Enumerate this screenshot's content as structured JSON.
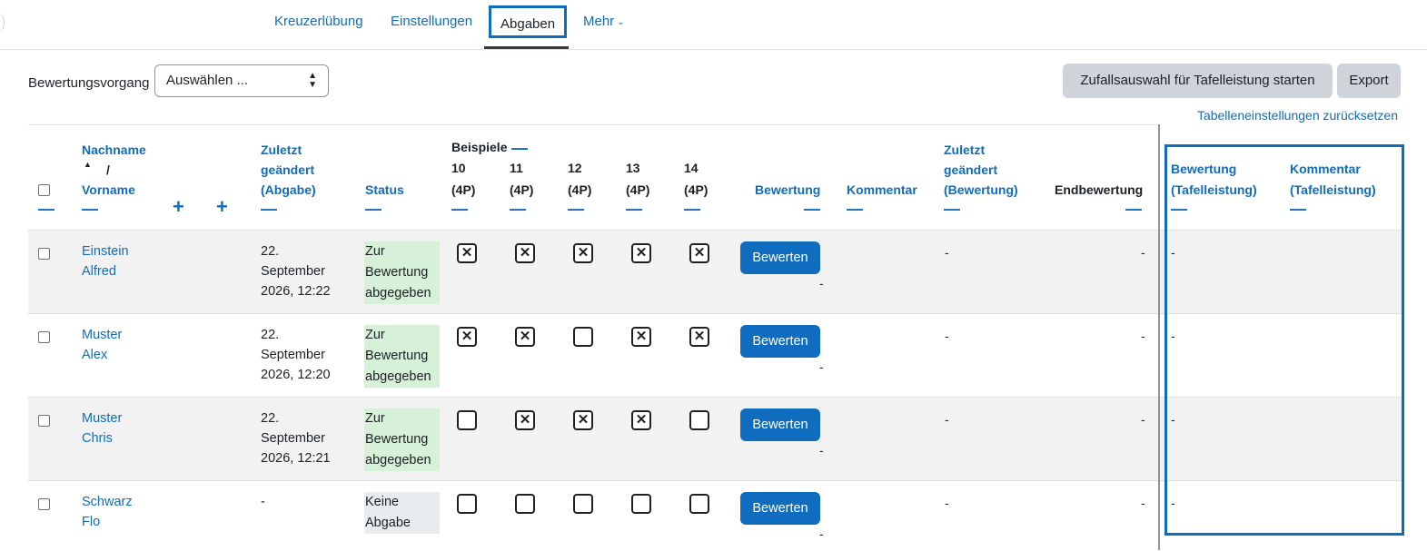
{
  "nav": {
    "tabs": [
      "Kreuzerlübung",
      "Einstellungen",
      "Abgaben",
      "Mehr"
    ],
    "active": "Abgaben"
  },
  "controls": {
    "grading_label": "Bewertungsvorgang",
    "select_value": "Auswählen ...",
    "random_button": "Zufallsauswahl für Tafelleistung starten",
    "export_button": "Export",
    "reset_link": "Tabelleneinstellungen zurücksetzen"
  },
  "headers": {
    "nachname": "Nachname",
    "slash": "/",
    "vorname": "Vorname",
    "modified_submission": [
      "Zuletzt",
      "geändert",
      "(Abgabe)"
    ],
    "status": "Status",
    "examples": "Beispiele",
    "example_cols": [
      {
        "num": "10",
        "pts": "(4P)"
      },
      {
        "num": "11",
        "pts": "(4P)"
      },
      {
        "num": "12",
        "pts": "(4P)"
      },
      {
        "num": "13",
        "pts": "(4P)"
      },
      {
        "num": "14",
        "pts": "(4P)"
      }
    ],
    "grade": "Bewertung",
    "comment": "Kommentar",
    "modified_grade": [
      "Zuletzt",
      "geändert",
      "(Bewertung)"
    ],
    "final_grade": "Endbewertung",
    "board_grade": [
      "Bewertung",
      "(Tafelleistung)"
    ],
    "board_comment": [
      "Kommentar",
      "(Tafelleistung)"
    ],
    "collapse_symbol": "—",
    "expand_symbol": "+"
  },
  "rows": [
    {
      "lastname": "Einstein",
      "firstname": "Alfred",
      "modified": [
        "22.",
        "September",
        "2026, 12:22"
      ],
      "status": [
        "Zur",
        "Bewertung",
        "abgegeben"
      ],
      "status_kind": "submitted",
      "checks": [
        true,
        true,
        true,
        true,
        true
      ],
      "grade_button": "Bewerten",
      "grade_value": "-",
      "modified_grade": "-",
      "final": "-",
      "board": "-"
    },
    {
      "lastname": "Muster",
      "firstname": "Alex",
      "modified": [
        "22.",
        "September",
        "2026, 12:20"
      ],
      "status": [
        "Zur",
        "Bewertung",
        "abgegeben"
      ],
      "status_kind": "submitted",
      "checks": [
        true,
        true,
        false,
        true,
        true
      ],
      "grade_button": "Bewerten",
      "grade_value": "-",
      "modified_grade": "-",
      "final": "-",
      "board": "-"
    },
    {
      "lastname": "Muster",
      "firstname": "Chris",
      "modified": [
        "22.",
        "September",
        "2026, 12:21"
      ],
      "status": [
        "Zur",
        "Bewertung",
        "abgegeben"
      ],
      "status_kind": "submitted",
      "checks": [
        false,
        true,
        true,
        true,
        false
      ],
      "grade_button": "Bewerten",
      "grade_value": "-",
      "modified_grade": "-",
      "final": "-",
      "board": "-"
    },
    {
      "lastname": "Schwarz",
      "firstname": "Flo",
      "modified": [
        "-"
      ],
      "status": [
        "Keine",
        "Abgabe"
      ],
      "status_kind": "none",
      "checks": [
        false,
        false,
        false,
        false,
        false
      ],
      "grade_button": "Bewerten",
      "grade_value": "-",
      "modified_grade": "-",
      "final": "-",
      "board": "-"
    }
  ],
  "colors": {
    "link": "#0f6cbf",
    "submitted_bg": "#d7f0d8",
    "none_bg": "#e9ecef",
    "button_primary": "#0f6cbf",
    "button_secondary": "#ced4da"
  },
  "icons": [
    "sort-up-icon",
    "chevron-down-icon",
    "select-arrows-icon",
    "checkbox-icon",
    "crossed-box-icon"
  ]
}
